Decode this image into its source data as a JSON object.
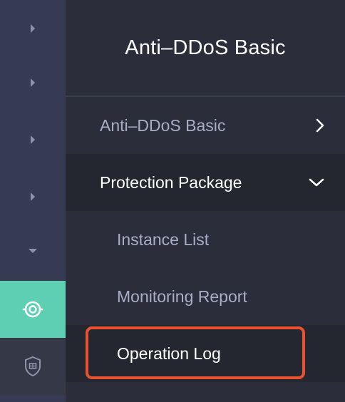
{
  "rail": {
    "items": [
      {
        "icon": "chevron-right-icon"
      },
      {
        "icon": "chevron-right-icon"
      },
      {
        "icon": "chevron-right-icon"
      },
      {
        "icon": "chevron-right-icon"
      },
      {
        "icon": "caret-down-icon"
      },
      {
        "icon": "ddos-protection-icon",
        "active": true
      },
      {
        "icon": "shield-icon"
      }
    ],
    "active_color": "#5ecfb3"
  },
  "panel": {
    "title": "Anti–DDoS Basic",
    "menu": {
      "anti_ddos_basic": {
        "label": "Anti–DDoS Basic",
        "icon": "chevron-right-icon"
      },
      "protection_package": {
        "label": "Protection Package",
        "icon": "chevron-down-icon",
        "expanded": true,
        "children": [
          {
            "label": "Instance List"
          },
          {
            "label": "Monitoring Report"
          },
          {
            "label": "Operation Log",
            "selected": true
          }
        ]
      }
    }
  },
  "colors": {
    "highlight_border": "#e9522e",
    "rail_bg": "#363a52",
    "panel_bg": "#2b2d3a"
  }
}
